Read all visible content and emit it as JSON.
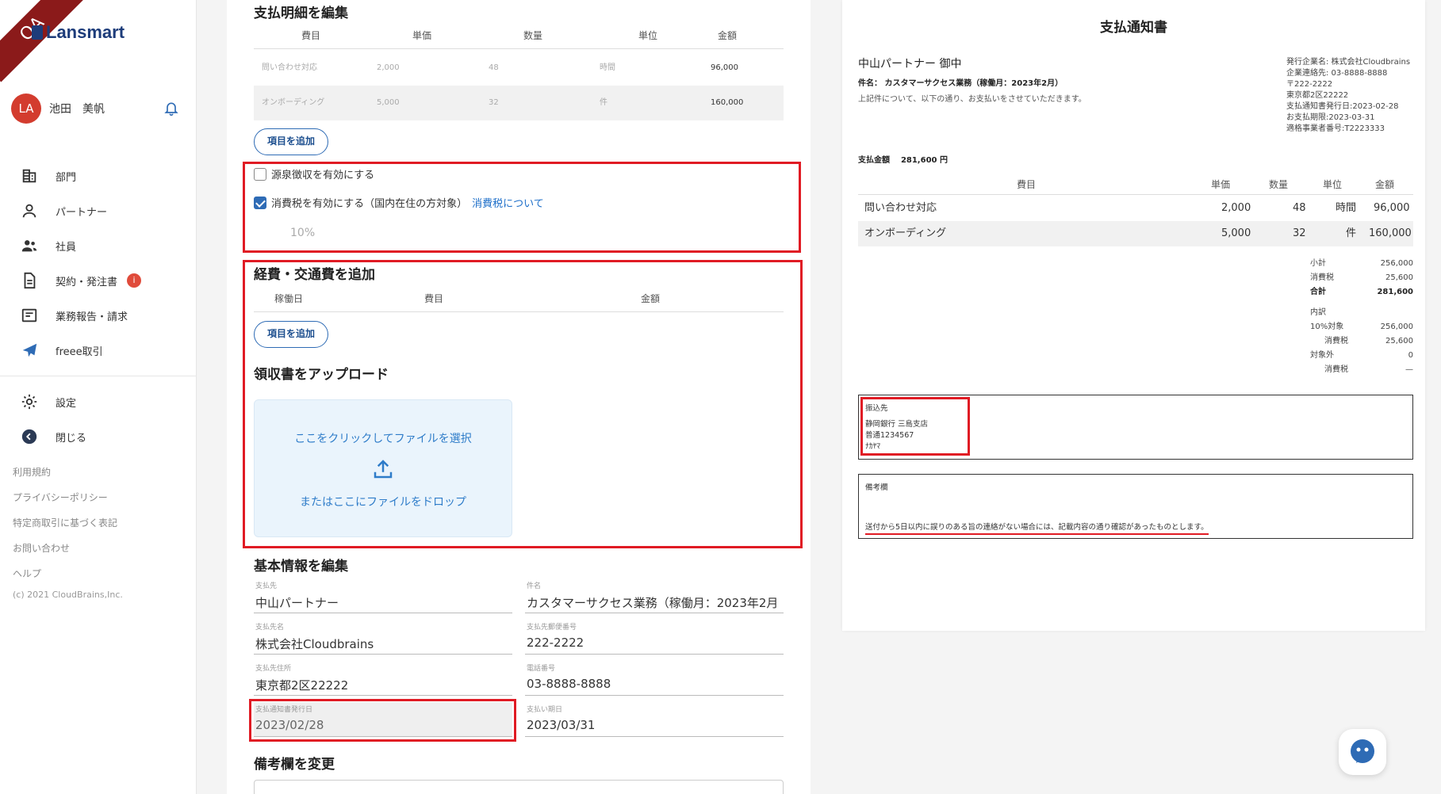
{
  "sidebar": {
    "ribbon": "QA",
    "logo": "Lansmart",
    "avatar_initials": "LA",
    "user_name": "池田　美帆",
    "nav": [
      {
        "label": "部門"
      },
      {
        "label": "パートナー"
      },
      {
        "label": "社員"
      },
      {
        "label": "契約・発注書",
        "badge": "i"
      },
      {
        "label": "業務報告・請求"
      },
      {
        "label": "freee取引"
      }
    ],
    "settings": "設定",
    "close": "閉じる",
    "links": [
      "利用規約",
      "プライバシーポリシー",
      "特定商取引に基づく表記",
      "お問い合わせ",
      "ヘルプ"
    ],
    "copyright": "(c) 2021 CloudBrains,Inc."
  },
  "form": {
    "payment_details_title": "支払明細を編集",
    "columns": [
      "費目",
      "単価",
      "数量",
      "単位",
      "金額"
    ],
    "rows": [
      {
        "item": "問い合わせ対応",
        "unit_price": "2,000",
        "qty": "48",
        "unit": "時間",
        "amount": "96,000"
      },
      {
        "item": "オンボーディング",
        "unit_price": "5,000",
        "qty": "32",
        "unit": "件",
        "amount": "160,000"
      }
    ],
    "add_item": "項目を追加",
    "withholding_label": "源泉徴収を有効にする",
    "withholding_checked": false,
    "consumption_tax_label": "消費税を有効にする（国内在住の方対象）",
    "consumption_tax_link": "消費税について",
    "consumption_tax_checked": true,
    "tax_rate": "10%",
    "expenses_title": "経費・交通費を追加",
    "expense_columns": [
      "稼働日",
      "費目",
      "金額"
    ],
    "add_expense": "項目を追加",
    "receipt_title": "領収書をアップロード",
    "upload_click": "ここをクリックしてファイルを選択",
    "upload_drop": "またはここにファイルをドロップ",
    "basic_info_title": "基本情報を編集",
    "fields": {
      "payee": {
        "label": "支払先",
        "value": "中山パートナー"
      },
      "subject": {
        "label": "件名",
        "value": "カスタマーサクセス業務（稼働月：2023年2月"
      },
      "payer_name": {
        "label": "支払先名",
        "value": "株式会社Cloudbrains"
      },
      "postal": {
        "label": "支払先郵便番号",
        "value": "222-2222"
      },
      "address": {
        "label": "支払先住所",
        "value": "東京都2区22222"
      },
      "phone": {
        "label": "電話番号",
        "value": "03-8888-8888"
      },
      "issue_date": {
        "label": "支払通知書発行日",
        "value": "2023/02/28"
      },
      "due_date": {
        "label": "支払い期日",
        "value": "2023/03/31"
      }
    },
    "remarks_title": "備考欄を変更"
  },
  "preview": {
    "title": "支払通知書",
    "addressee": "中山パートナー 御中",
    "subject": "件名： カスタマーサクセス業務（稼働月：2023年2月）",
    "intro": "上記件について、以下の通り、お支払いをさせていただきます。",
    "issuer": [
      "発行企業名: 株式会社Cloudbrains",
      "企業連絡先: 03-8888-8888",
      "〒222-2222",
      "東京都2区22222",
      "支払通知書発行日:2023-02-28",
      "お支払期限:2023-03-31",
      "適格事業者番号:T2223333"
    ],
    "amount_label": "支払金額",
    "amount_value": "281,600 円",
    "columns": [
      "費目",
      "単価",
      "数量",
      "単位",
      "金額"
    ],
    "rows": [
      {
        "item": "問い合わせ対応",
        "unit_price": "2,000",
        "qty": "48",
        "unit": "時間",
        "amount": "96,000"
      },
      {
        "item": "オンボーディング",
        "unit_price": "5,000",
        "qty": "32",
        "unit": "件",
        "amount": "160,000"
      }
    ],
    "subtotal_label": "小計",
    "subtotal": "256,000",
    "tax_label": "消費税",
    "tax": "25,600",
    "total_label": "合計",
    "total": "281,600",
    "breakdown_label": "内訳",
    "ten_pct_label": "10%対象",
    "ten_pct": "256,000",
    "ten_pct_tax_label": "消費税",
    "ten_pct_tax": "25,600",
    "exempt_label": "対象外",
    "exempt": "0",
    "exempt_tax_label": "消費税",
    "exempt_tax": "—",
    "bank_title": "振込先",
    "bank_lines": [
      "静岡銀行 三島支店",
      "普通1234567",
      "ﾅｶﾔﾏ"
    ],
    "remarks_title": "備考欄",
    "remarks_text": "送付から5日以内に誤りのある旨の連絡がない場合には、記載内容の通り確認があったものとします。"
  },
  "colors": {
    "accent": "#2e6bb5",
    "highlight": "#e01b24",
    "avatar": "#d33c2e",
    "ribbon": "#8b1a1a"
  }
}
